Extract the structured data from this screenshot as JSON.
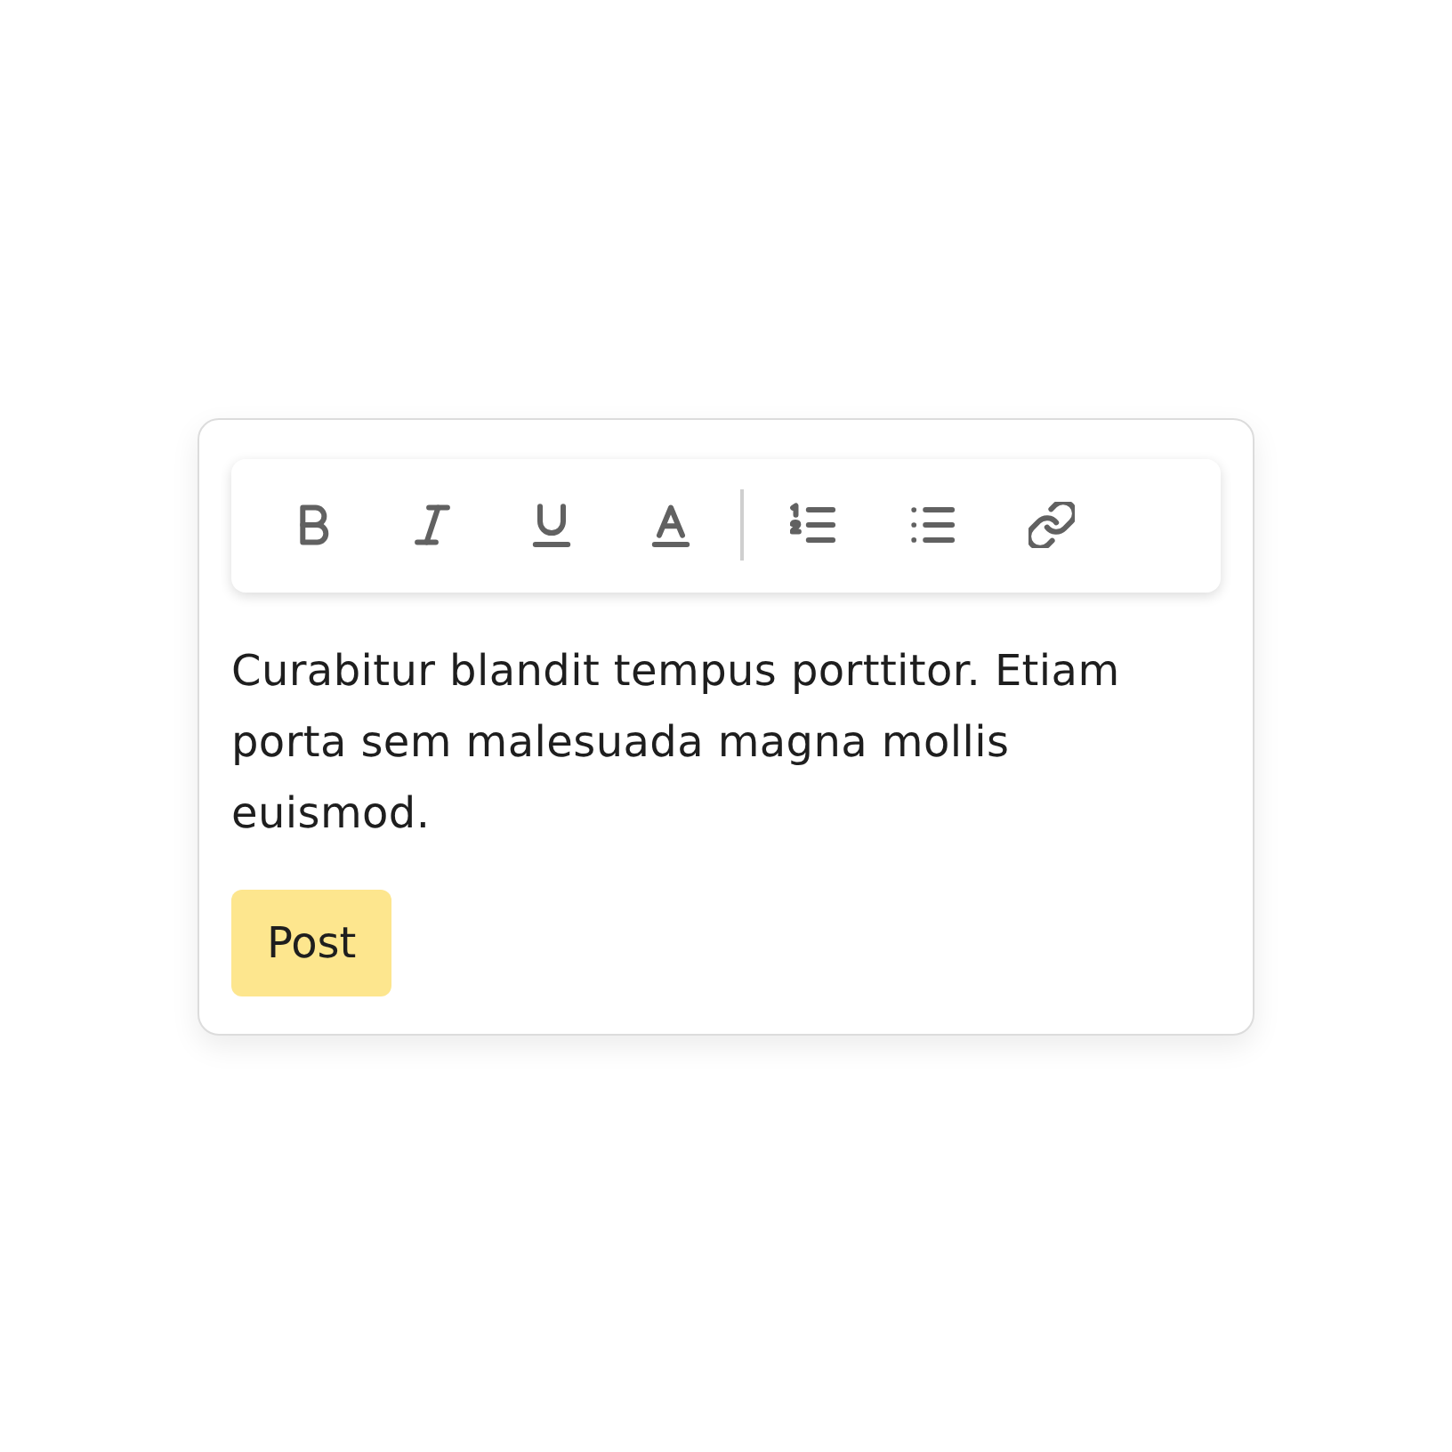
{
  "toolbar": {
    "groups": [
      {
        "buttons": [
          {
            "kind": "bold"
          },
          {
            "kind": "italic"
          },
          {
            "kind": "underline"
          },
          {
            "kind": "text_color"
          }
        ]
      },
      {
        "buttons": [
          {
            "kind": "ordered_list"
          },
          {
            "kind": "bullet_list"
          },
          {
            "kind": "link"
          }
        ]
      }
    ]
  },
  "editor": {
    "text": "Curabitur blandit tempus porttitor. Etiam porta sem malesuada magna mollis euismod."
  },
  "post_button": {
    "label": "Post"
  }
}
